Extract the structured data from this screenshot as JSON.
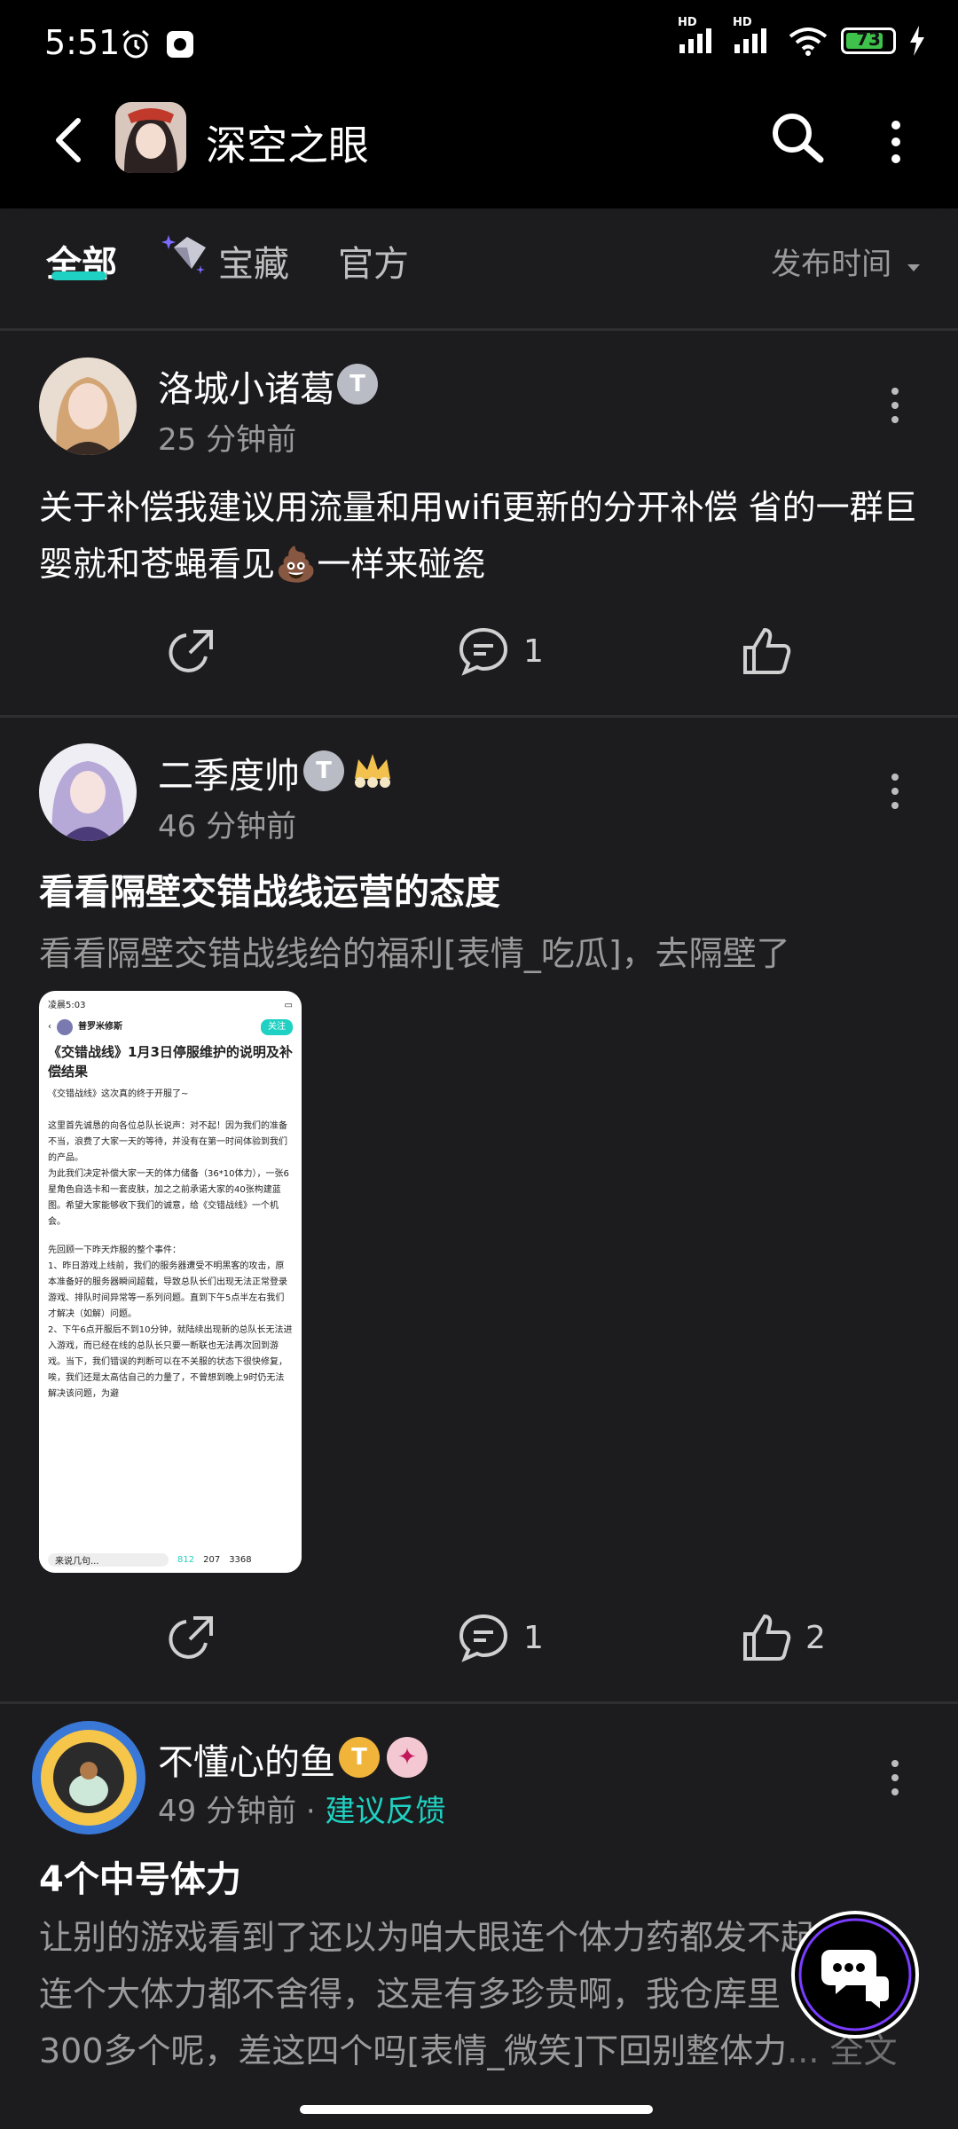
{
  "status_bar": {
    "time": "5:51",
    "battery": "73",
    "hd1": "HD",
    "hd2": "HD"
  },
  "header": {
    "title": "深空之眼"
  },
  "tabs": {
    "all": "全部",
    "treasure": "宝藏",
    "official": "官方",
    "sort": "发布时间"
  },
  "posts": [
    {
      "username": "洛城小诸葛",
      "time": "25 分钟前",
      "text": "关于补偿我建议用流量和用wifi更新的分开补偿 省的一群巨婴就和苍蝇看见💩一样来碰瓷",
      "comments": "1",
      "likes": ""
    },
    {
      "username": "二季度帅",
      "time": "46 分钟前",
      "title": "看看隔壁交错战线运营的态度",
      "text": "看看隔壁交错战线给的福利[表情_吃瓜]，去隔壁了",
      "comments": "1",
      "likes": "2",
      "thumb": {
        "status": "凌晨5:03",
        "author": "普罗米修斯",
        "follow": "关注",
        "title": "《交错战线》1月3日停服维护的说明及补偿结果",
        "body1": "《交错战线》这次真的终于开服了~",
        "body2": "这里首先诚恳的向各位总队长说声：对不起！因为我们的准备不当，浪费了大家一天的等待，并没有在第一时间体验到我们的产品。",
        "body3": "为此我们决定补偿大家一天的体力储备（36*10体力），一张6星角色自选卡和一套皮肤，加之之前承诺大家的40张构建蓝图。希望大家能够收下我们的诚意，给《交错战线》一个机会。",
        "body4": "先回顾一下昨天炸服的整个事件：",
        "body5": "1、昨日游戏上线前，我们的服务器遭受不明黑客的攻击，原本准备好的服务器瞬间超载，导致总队长们出现无法正常登录游戏、排队时间异常等一系列问题。直到下午5点半左右我们才解决（如解）问题。",
        "body6": "2、下午6点开服后不到10分钟，就陆续出现新的总队长无法进入游戏，而已经在线的总队长只要一断联也无法再次回到游戏。当下，我们错误的判断可以在不关服的状态下很快修复，唉，我们还是太高估自己的力量了，不曾想到晚上9时仍无法解决该问题，为避",
        "reply": "来说几句...",
        "f_like": "812",
        "f_star": "207",
        "f_comment": "3368"
      }
    },
    {
      "username": "不懂心的鱼",
      "time": "49 分钟前",
      "tag": "建议反馈",
      "title": "4个中号体力",
      "line1": "让别的游戏看到了还以为咱大眼连个体力药都发不起",
      "line2": "连个大体力都不舍得，这是有多珍贵啊，我仓库里",
      "line3": "300多个呢，差这四个吗[表情_微笑]下回别整体力",
      "more": "... 全文"
    }
  ]
}
